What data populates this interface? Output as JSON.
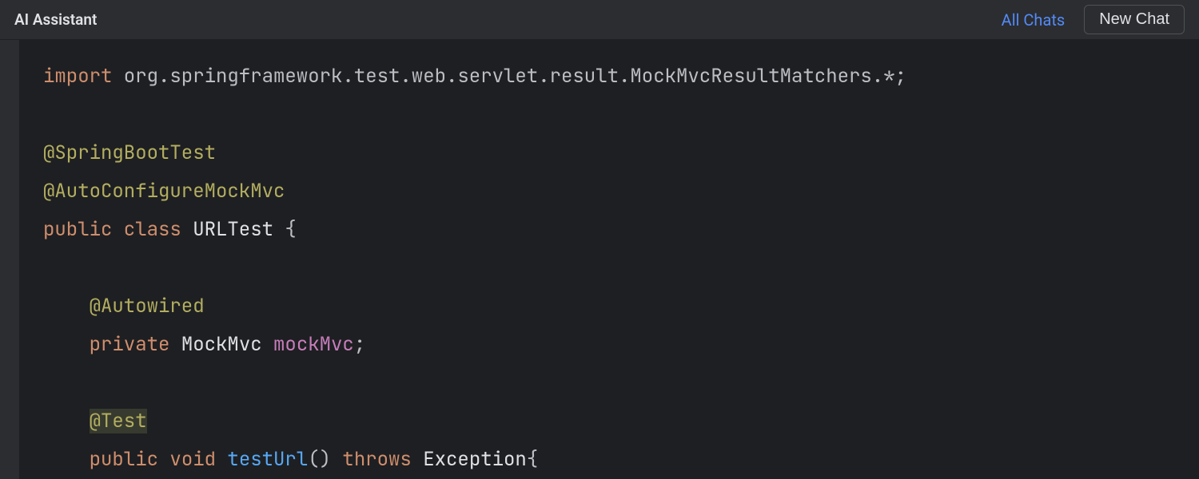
{
  "header": {
    "title": "AI Assistant",
    "all_chats_label": "All Chats",
    "new_chat_label": "New Chat"
  },
  "code": {
    "line1_import": "import",
    "line1_rest": " org.springframework.test.web.servlet.result.MockMvcResultMatchers.*;",
    "line3_springboot": "@SpringBootTest",
    "line4_autoconfig": "@AutoConfigureMockMvc",
    "line5_public": "public",
    "line5_class": " class",
    "line5_name": " URLTest ",
    "line5_brace": "{",
    "line7_autowired": "@Autowired",
    "line8_private": "private",
    "line8_type": " MockMvc ",
    "line8_field": "mockMvc",
    "line8_semi": ";",
    "line10_test": "@Test",
    "line11_public": "public",
    "line11_void": " void",
    "line11_method": " testUrl",
    "line11_parens": "() ",
    "line11_throws": "throws",
    "line11_exc": " Exception",
    "line11_brace": "{",
    "indent1": "    ",
    "indent2": "    "
  }
}
